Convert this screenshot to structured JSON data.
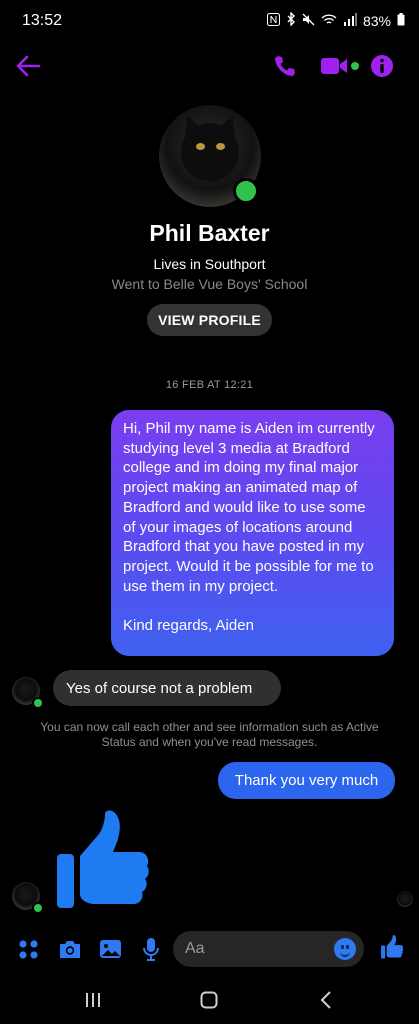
{
  "status_bar": {
    "time": "13:52",
    "battery": "83%",
    "icons": [
      "nfc-icon",
      "bluetooth-icon",
      "mute-icon",
      "wifi-icon",
      "signal-icon",
      "battery-icon"
    ]
  },
  "header": {
    "back_icon": "back-arrow-icon",
    "call_icon": "phone-icon",
    "video_icon": "video-camera-icon",
    "info_icon": "info-icon",
    "accent_color": "#a020f0"
  },
  "profile": {
    "name": "Phil Baxter",
    "lives_in": "Lives in Southport",
    "education": "Went to Belle Vue Boys' School",
    "view_profile_label": "VIEW PROFILE",
    "online": true
  },
  "conversation": {
    "timestamp": "16 FEB AT 12:21",
    "messages": [
      {
        "direction": "outgoing",
        "text": "Hi, Phil my name is Aiden im currently studying level 3 media at Bradford college and im doing my final major project making an animated map of Bradford and would like to use some of your images of locations around Bradford that you have posted in my project. Would it be possible for me to use them in my project.\n\nKind regards, Aiden"
      },
      {
        "direction": "incoming",
        "text": "Yes of course not a problem"
      },
      {
        "direction": "system",
        "text": "You can now call each other and see information such as Active Status and when you've read messages."
      },
      {
        "direction": "outgoing",
        "text": "Thank you very much"
      },
      {
        "direction": "incoming",
        "sticker": "thumbs-up-icon"
      }
    ]
  },
  "composer": {
    "placeholder": "Aa",
    "icons": [
      "apps-icon",
      "camera-icon",
      "gallery-icon",
      "microphone-icon",
      "emoji-icon",
      "thumbs-up-icon"
    ],
    "accent_color": "#2f7af1"
  },
  "nav_bar": {
    "icons": [
      "recent-apps-icon",
      "home-icon",
      "back-icon"
    ]
  }
}
